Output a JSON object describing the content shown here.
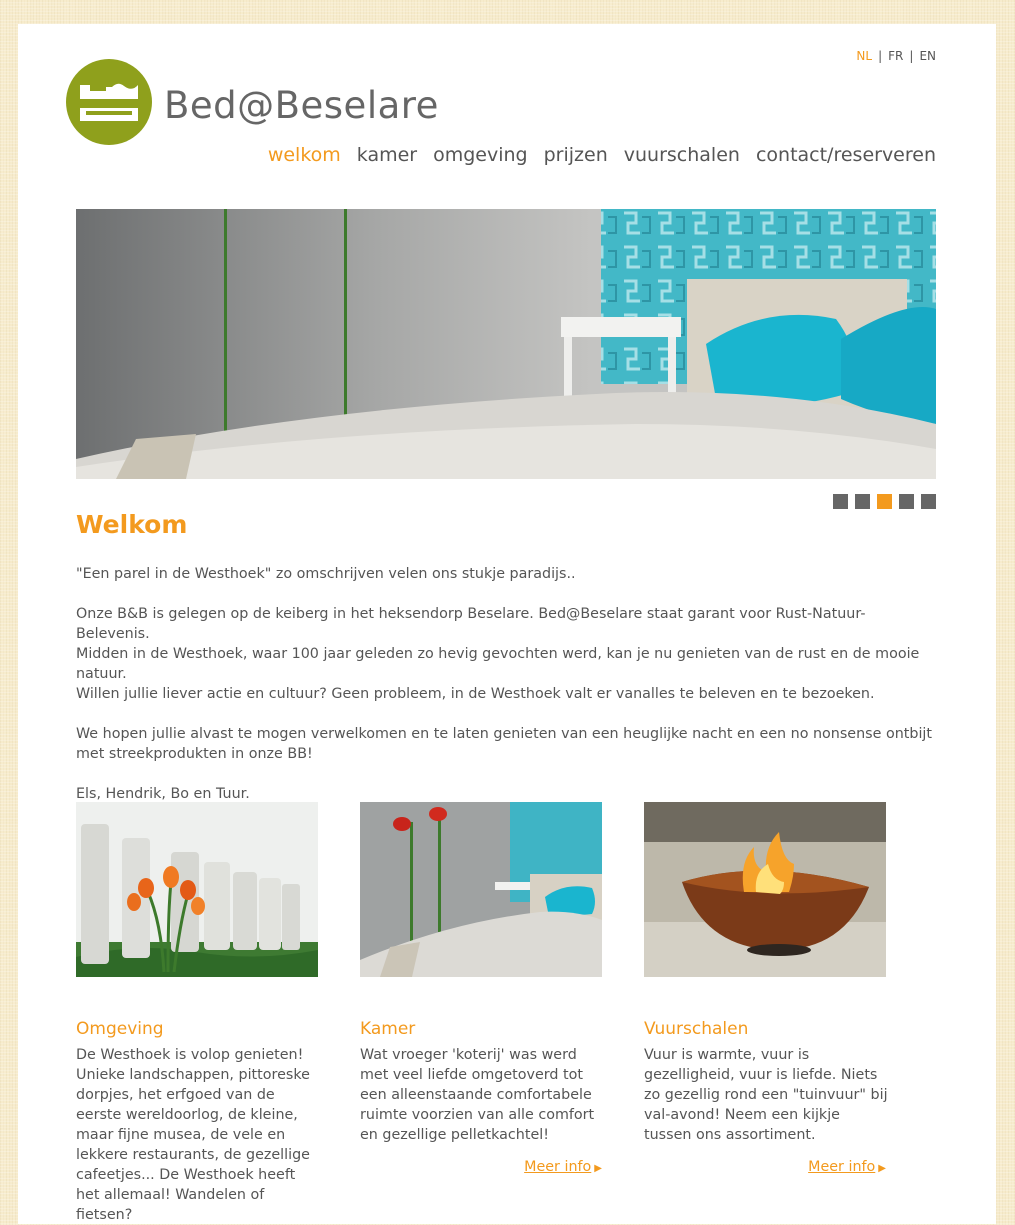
{
  "site": {
    "brand": "Bed@Beselare"
  },
  "lang": {
    "items": [
      "NL",
      "FR",
      "EN"
    ],
    "active": "NL",
    "separator": "|"
  },
  "nav": {
    "items": [
      "welkom",
      "kamer",
      "omgeving",
      "prijzen",
      "vuurschalen",
      "contact/reserveren"
    ]
  },
  "slider": {
    "count": 5,
    "active_index": 2
  },
  "main": {
    "title": "Welkom",
    "p1": "\"Een parel in de Westhoek\"  zo omschrijven velen ons stukje paradijs..",
    "p2_l1": "Onze B&B is gelegen op de keiberg in het heksendorp Beselare. Bed@Beselare staat garant voor Rust-Natuur-Belevenis.",
    "p2_l2": "Midden in de Westhoek, waar 100 jaar geleden zo hevig gevochten werd, kan je nu genieten van de rust en de mooie natuur.",
    "p2_l3": "Willen jullie liever actie en cultuur? Geen probleem, in de Westhoek valt er vanalles te beleven en te bezoeken.",
    "p3": "We hopen jullie alvast te mogen verwelkomen en te laten genieten van een heuglijke nacht en een no nonsense ontbijt met streekprodukten in onze BB!",
    "p4": "Els, Hendrik, Bo en Tuur."
  },
  "cards": [
    {
      "title": "Omgeving",
      "text": "De Westhoek is volop genieten! Unieke landschappen, pittoreske dorpjes, het erfgoed van de eerste wereldoorlog, de kleine, maar fijne musea, de vele en lekkere restaurants, de gezellige cafeetjes... De Westhoek heeft het allemaal! Wandelen of fietsen?",
      "more": ""
    },
    {
      "title": "Kamer",
      "text": "Wat vroeger 'koterij' was werd met veel liefde omgetoverd tot een alleenstaande comfortabele ruimte voorzien van alle comfort en gezellige pelletkachtel!",
      "more": "Meer info"
    },
    {
      "title": "Vuurschalen",
      "text": "Vuur is warmte, vuur is gezelligheid, vuur is liefde. Niets zo gezellig rond een \"tuinvuur\" bij val-avond! Neem een kijkje tussen ons assortiment.",
      "more": "Meer info"
    }
  ],
  "colors": {
    "accent": "#f39a1e",
    "logo": "#8fa01c",
    "text": "#555555"
  }
}
